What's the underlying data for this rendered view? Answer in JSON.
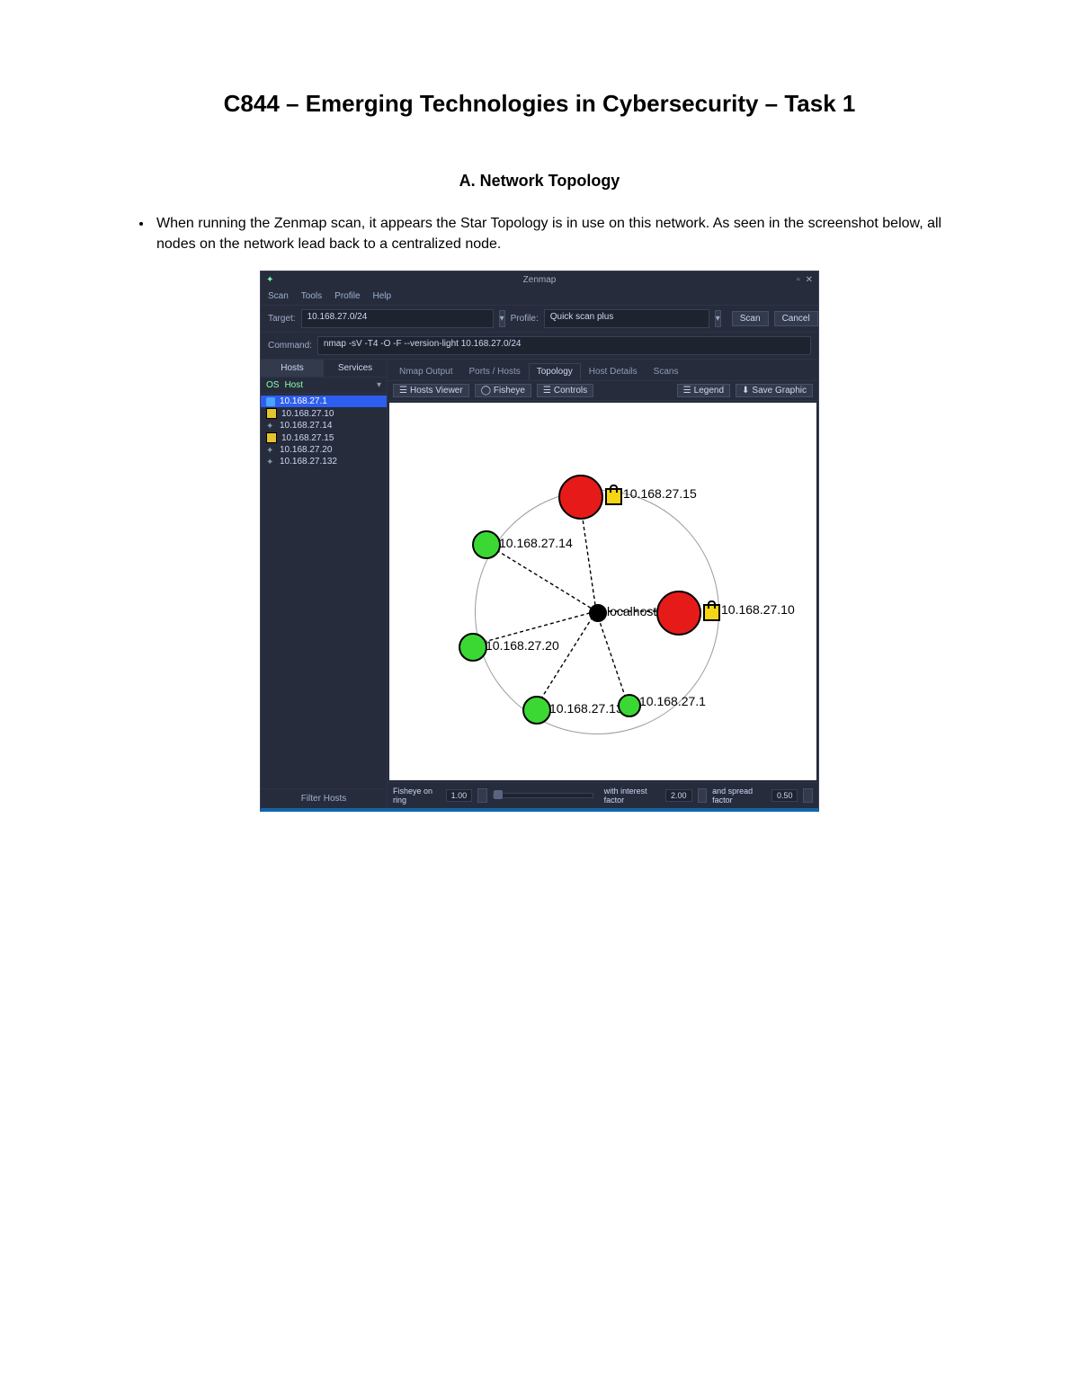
{
  "doc": {
    "title": "C844 – Emerging Technologies in Cybersecurity – Task 1",
    "section": "A. Network Topology",
    "bullet": "When running the Zenmap scan, it appears the Star Topology is in use on this network. As seen in the screenshot below, all nodes on the network lead back to a centralized node."
  },
  "app": {
    "title": "Zenmap",
    "menu": {
      "scan": "Scan",
      "tools": "Tools",
      "profile": "Profile",
      "help": "Help"
    },
    "target_label": "Target:",
    "target_value": "10.168.27.0/24",
    "profile_label": "Profile:",
    "profile_value": "Quick scan plus",
    "scan_btn": "Scan",
    "cancel_btn": "Cancel",
    "command_label": "Command:",
    "command_value": "nmap -sV -T4 -O -F --version-light 10.168.27.0/24",
    "side_tabs": {
      "hosts": "Hosts",
      "services": "Services"
    },
    "side_head": {
      "os": "OS",
      "host": "Host"
    },
    "hosts": [
      {
        "ip": "10.168.27.1",
        "icon": "blue",
        "sel": true
      },
      {
        "ip": "10.168.27.10",
        "icon": "yellow",
        "sel": false
      },
      {
        "ip": "10.168.27.14",
        "icon": "dots",
        "sel": false
      },
      {
        "ip": "10.168.27.15",
        "icon": "yellow",
        "sel": false
      },
      {
        "ip": "10.168.27.20",
        "icon": "dots",
        "sel": false
      },
      {
        "ip": "10.168.27.132",
        "icon": "dots",
        "sel": false
      }
    ],
    "filter": "Filter Hosts",
    "main_tabs": {
      "nmap_output": "Nmap Output",
      "ports_hosts": "Ports / Hosts",
      "topology": "Topology",
      "host_details": "Host Details",
      "scans": "Scans"
    },
    "toolbar": {
      "hosts_viewer": "Hosts Viewer",
      "fisheye": "Fisheye",
      "controls": "Controls",
      "legend": "Legend",
      "save": "Save Graphic"
    },
    "topology": {
      "center_label": "localhost",
      "nodes": {
        "n15": "10.168.27.15",
        "n14": "10.168.27.14",
        "n10": "10.168.27.10",
        "n20": "10.168.27.20",
        "n132": "10.168.27.132",
        "n1": "10.168.27.1"
      }
    },
    "bottom": {
      "fisheye_label": "Fisheye on ring",
      "fisheye_val": "1.00",
      "interest_label": "with interest factor",
      "interest_val": "2.00",
      "spread_label": "and spread factor",
      "spread_val": "0.50"
    }
  }
}
